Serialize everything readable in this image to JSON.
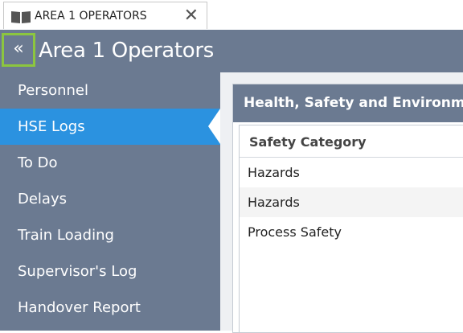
{
  "tab": {
    "title": "AREA 1 OPERATORS",
    "close_symbol": "✕",
    "icon": "book-icon"
  },
  "header": {
    "collapse_symbol": "«",
    "collapse_icon": "double-chevron-left-icon",
    "title": "Area 1 Operators"
  },
  "sidebar": {
    "items": [
      {
        "label": "Personnel",
        "active": false
      },
      {
        "label": "HSE Logs",
        "active": true
      },
      {
        "label": "To Do",
        "active": false
      },
      {
        "label": "Delays",
        "active": false
      },
      {
        "label": "Train Loading",
        "active": false
      },
      {
        "label": "Supervisor's Log",
        "active": false
      },
      {
        "label": "Handover Report",
        "active": false
      }
    ]
  },
  "panel": {
    "title": "Health, Safety and Environment"
  },
  "grid": {
    "columns": [
      "Safety Category"
    ],
    "rows": [
      [
        "Hazards"
      ],
      [
        "Hazards"
      ],
      [
        "Process Safety"
      ]
    ]
  },
  "colors": {
    "header_bg": "#6b7a91",
    "active_item": "#2b92e0",
    "collapse_border": "#8cc63f"
  }
}
